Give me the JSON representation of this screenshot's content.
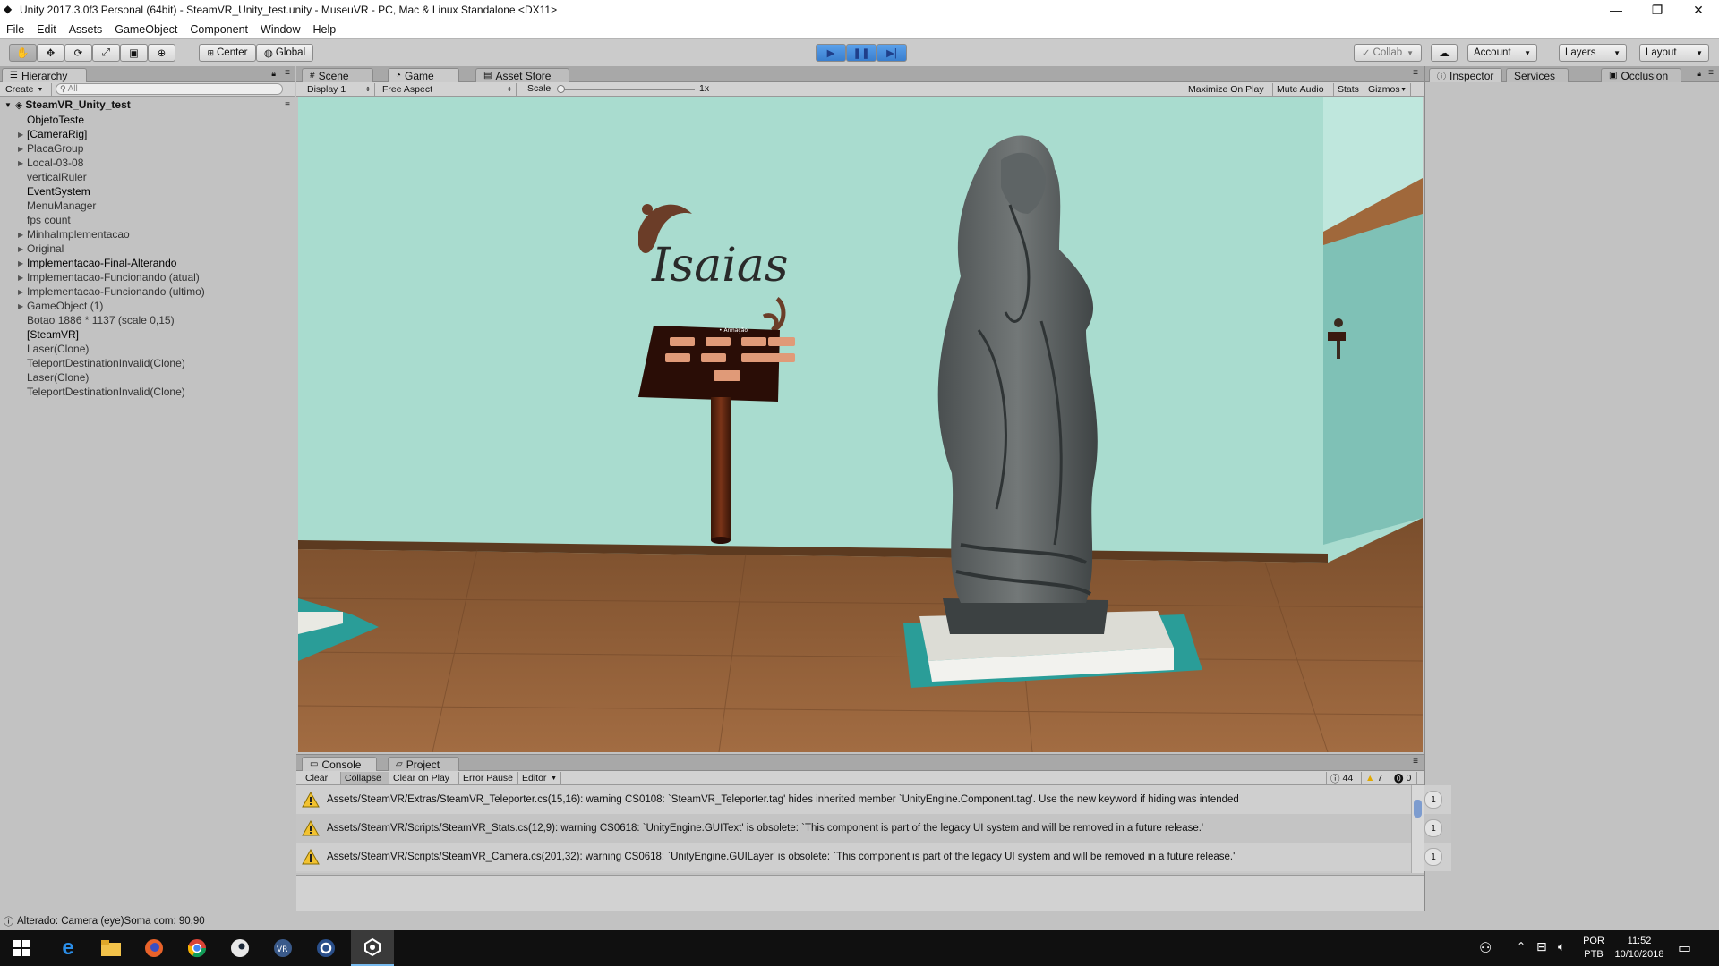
{
  "window": {
    "title": "Unity 2017.3.0f3 Personal (64bit) - SteamVR_Unity_test.unity - MuseuVR - PC, Mac & Linux Standalone <DX11>",
    "minimize": "—",
    "maximize": "❐",
    "close": "✕"
  },
  "menu": [
    "File",
    "Edit",
    "Assets",
    "GameObject",
    "Component",
    "Window",
    "Help"
  ],
  "toolbar": {
    "center": "Center",
    "global": "Global",
    "collab": "Collab",
    "account": "Account",
    "layers": "Layers",
    "layout": "Layout"
  },
  "hierarchy": {
    "tab": "Hierarchy",
    "create": "Create",
    "search_placeholder": "All",
    "scene": "SteamVR_Unity_test",
    "items": [
      {
        "label": "ObjetoTeste",
        "arrow": false,
        "dark": true
      },
      {
        "label": "[CameraRig]",
        "arrow": true,
        "dark": true
      },
      {
        "label": "PlacaGroup",
        "arrow": true,
        "dark": false
      },
      {
        "label": "Local-03-08",
        "arrow": true,
        "dark": false
      },
      {
        "label": "verticalRuler",
        "arrow": false,
        "dark": false
      },
      {
        "label": "EventSystem",
        "arrow": false,
        "dark": true
      },
      {
        "label": "MenuManager",
        "arrow": false,
        "dark": false
      },
      {
        "label": "fps count",
        "arrow": false,
        "dark": false
      },
      {
        "label": "MinhaImplementacao",
        "arrow": true,
        "dark": false
      },
      {
        "label": "Original",
        "arrow": true,
        "dark": false
      },
      {
        "label": "Implementacao-Final-Alterando",
        "arrow": true,
        "dark": true
      },
      {
        "label": "Implementacao-Funcionando (atual)",
        "arrow": true,
        "dark": false
      },
      {
        "label": "Implementacao-Funcionando (ultimo)",
        "arrow": true,
        "dark": false
      },
      {
        "label": "GameObject (1)",
        "arrow": true,
        "dark": false
      },
      {
        "label": "Botao 1886 * 1137 (scale 0,15)",
        "arrow": false,
        "dark": false
      },
      {
        "label": "[SteamVR]",
        "arrow": false,
        "dark": true
      },
      {
        "label": "Laser(Clone)",
        "arrow": false,
        "dark": false
      },
      {
        "label": "TeleportDestinationInvalid(Clone)",
        "arrow": false,
        "dark": false
      },
      {
        "label": "Laser(Clone)",
        "arrow": false,
        "dark": false
      },
      {
        "label": "TeleportDestinationInvalid(Clone)",
        "arrow": false,
        "dark": false
      }
    ]
  },
  "center_tabs": {
    "scene": "Scene",
    "game": "Game",
    "asset_store": "Asset Store"
  },
  "game_bar": {
    "display": "Display 1",
    "aspect": "Free Aspect",
    "scale_label": "Scale",
    "scale_value": "1x",
    "maximize": "Maximize On Play",
    "mute": "Mute Audio",
    "stats": "Stats",
    "gizmos": "Gizmos"
  },
  "game_view": {
    "sign_text": "Isaias",
    "panel_caption": "• Armação"
  },
  "inspector": {
    "inspector": "Inspector",
    "services": "Services",
    "occlusion": "Occlusion"
  },
  "console": {
    "tab_console": "Console",
    "tab_project": "Project",
    "clear": "Clear",
    "collapse": "Collapse",
    "clear_on_play": "Clear on Play",
    "error_pause": "Error Pause",
    "editor": "Editor",
    "count_info": "44",
    "count_warn": "7",
    "count_error": "0",
    "entries": [
      {
        "text": "Assets/SteamVR/Extras/SteamVR_Teleporter.cs(15,16): warning CS0108: `SteamVR_Teleporter.tag' hides inherited member `UnityEngine.Component.tag'. Use the new keyword if hiding was intended",
        "count": "1"
      },
      {
        "text": "Assets/SteamVR/Scripts/SteamVR_Stats.cs(12,9): warning CS0618: `UnityEngine.GUIText' is obsolete: `This component is part of the legacy UI system and will be removed in a future release.'",
        "count": "1"
      },
      {
        "text": "Assets/SteamVR/Scripts/SteamVR_Camera.cs(201,32): warning CS0618: `UnityEngine.GUILayer' is obsolete: `This component is part of the legacy UI system and will be removed in a future release.'",
        "count": "1"
      }
    ]
  },
  "status_bar": "Alterado: Camera (eye)Soma com: 90,90",
  "taskbar": {
    "lang1": "POR",
    "lang2": "PTB",
    "time": "11:52",
    "date": "10/10/2018"
  },
  "colors": {
    "warn": "#f2c230",
    "play_active": "#4a90e2",
    "wall": "#a9dccf",
    "floor": "#8a5a32"
  }
}
